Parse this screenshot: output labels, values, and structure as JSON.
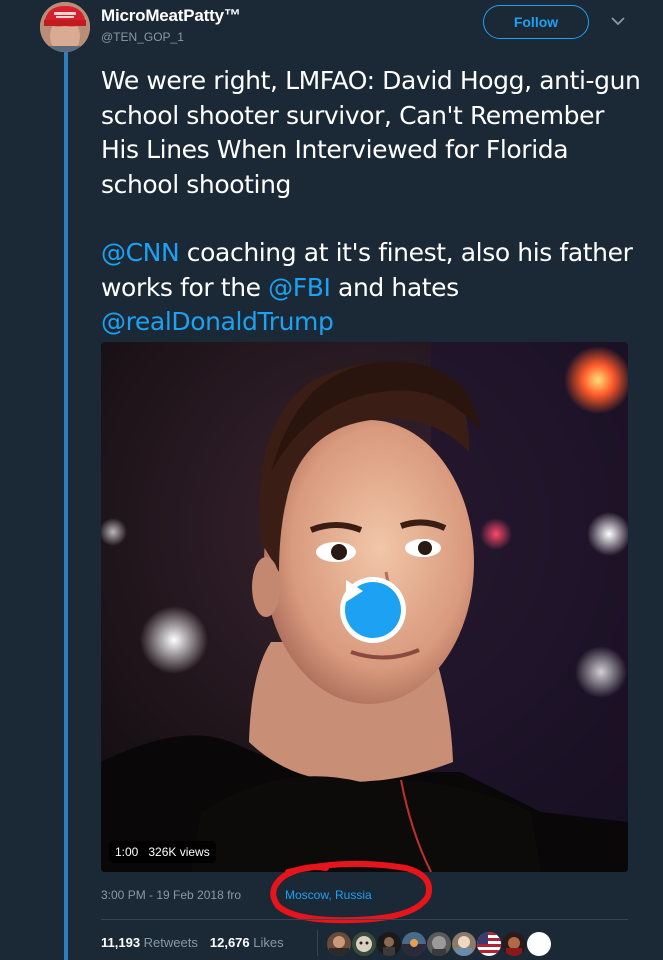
{
  "header": {
    "display_name": "MicroMeatPatty™",
    "handle": "@TEN_GOP_1",
    "follow_label": "Follow"
  },
  "tweet": {
    "paragraph1": "We were right, LMFAO: David Hogg, anti-gun school shooter survivor, Can't Remember His Lines When Interviewed for Florida school shooting",
    "mention_cnn": "@CNN",
    "text_a": " coaching at it's finest, also his father works for the ",
    "mention_fbi": "@FBI",
    "text_b": " and hates ",
    "mention_trump": "@realDonaldTrump"
  },
  "video": {
    "duration": "1:00",
    "views": "326K views"
  },
  "meta": {
    "timestamp": "3:00 PM - 19 Feb 2018 fro",
    "location": "Moscow, Russia"
  },
  "stats": {
    "retweets_count": "11,193",
    "retweets_label": "Retweets",
    "likes_count": "12,676",
    "likes_label": "Likes"
  },
  "colors": {
    "background": "#1b2836",
    "accent": "#1da1f2",
    "muted": "#8899a6",
    "annotation": "#e8141b"
  },
  "icons": [
    "chevron-down-icon",
    "play-icon"
  ]
}
